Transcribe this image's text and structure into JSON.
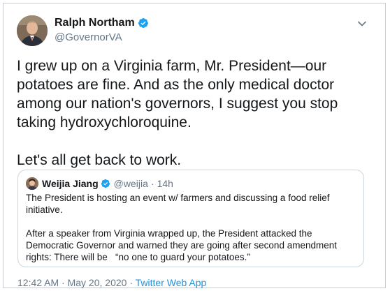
{
  "tweet": {
    "author_name": "Ralph Northam",
    "author_handle": "@GovernorVA",
    "paragraphs": [
      "I grew up on a Virginia farm, Mr. President—our potatoes are fine. And as the only medical doctor among our nation's governors, I suggest you stop taking hydroxychloroquine.",
      "Let's all get back to work."
    ],
    "timestamp": "12:42 AM · May 20, 2020",
    "separator": "·",
    "source": "Twitter Web App"
  },
  "quoted_tweet": {
    "author_name": "Weijia Jiang",
    "author_handle": "@weijia",
    "separator": "·",
    "time": "14h",
    "paragraphs": [
      "The President is hosting an event w/ farmers and discussing a food relief initiative.",
      "After a speaker from Virginia wrapped up, the President attacked the Democratic Governor and warned they are going after second amendment rights: There will be   “no one to guard your potatoes.”"
    ]
  },
  "colors": {
    "verified_badge": "#1da1f2",
    "secondary_text": "#657786",
    "link": "#1b95e0"
  },
  "icons": [
    "verified-badge-icon",
    "chevron-down-icon"
  ]
}
